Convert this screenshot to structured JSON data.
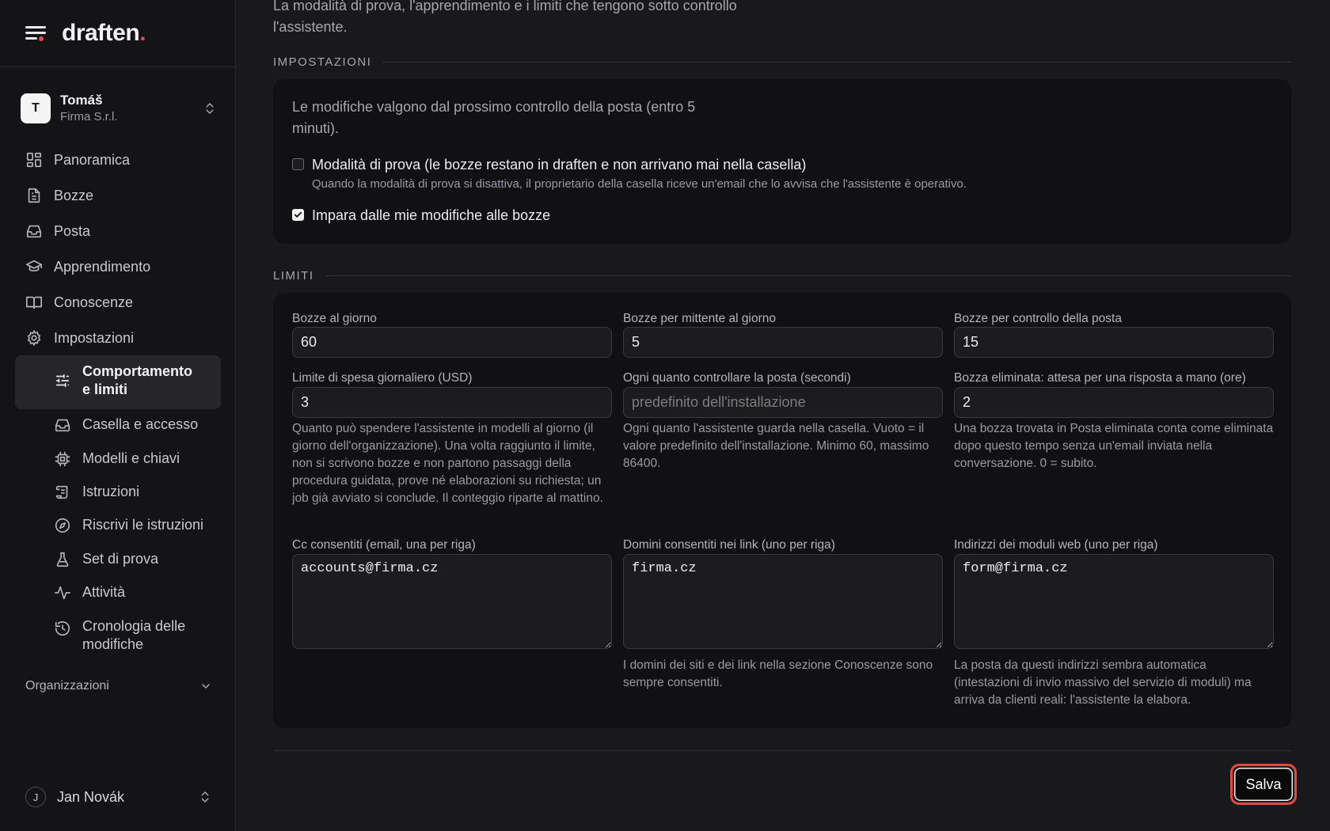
{
  "brand": {
    "logo_text": "draften",
    "logo_dot": "."
  },
  "org": {
    "avatar_letter": "T",
    "name": "Tomáš",
    "company": "Firma S.r.l."
  },
  "nav": {
    "items": [
      {
        "label": "Panoramica",
        "icon": "grid-icon"
      },
      {
        "label": "Bozze",
        "icon": "document-icon"
      },
      {
        "label": "Posta",
        "icon": "inbox-icon"
      },
      {
        "label": "Apprendimento",
        "icon": "graduation-cap-icon"
      },
      {
        "label": "Conoscenze",
        "icon": "book-open-icon"
      },
      {
        "label": "Impostazioni",
        "icon": "gear-icon"
      }
    ],
    "settings_sub": [
      {
        "label": "Comportamento e limiti",
        "icon": "sliders-icon",
        "active": true
      },
      {
        "label": "Casella e accesso",
        "icon": "inbox-icon"
      },
      {
        "label": "Modelli e chiavi",
        "icon": "cpu-icon"
      },
      {
        "label": "Istruzioni",
        "icon": "scroll-icon"
      },
      {
        "label": "Riscrivi le istruzioni",
        "icon": "compass-icon"
      },
      {
        "label": "Set di prova",
        "icon": "flask-icon"
      },
      {
        "label": "Attività",
        "icon": "activity-icon"
      },
      {
        "label": "Cronologia delle modifiche",
        "icon": "history-icon"
      }
    ],
    "organizations_label": "Organizzazioni"
  },
  "user": {
    "avatar_letter": "J",
    "name": "Jan Novák"
  },
  "intro_text": "La modalità di prova, l'apprendimento e i limiti che tengono sotto controllo l'assistente.",
  "impostazioni": {
    "heading": "IMPOSTAZIONI",
    "note": "Le modifiche valgono dal prossimo controllo della posta (entro 5 minuti).",
    "test_mode": {
      "label": "Modalità di prova (le bozze restano in draften e non arrivano mai nella casella)",
      "help": "Quando la modalità di prova si disattiva, il proprietario della casella riceve un'email che lo avvisa che l'assistente è operativo.",
      "checked": false
    },
    "learn": {
      "label": "Impara dalle mie modifiche alle bozze",
      "checked": true
    }
  },
  "limiti": {
    "heading": "LIMITI",
    "drafts_per_day": {
      "label": "Bozze al giorno",
      "value": "60"
    },
    "drafts_per_sender": {
      "label": "Bozze per mittente al giorno",
      "value": "5"
    },
    "drafts_per_check": {
      "label": "Bozze per controllo della posta",
      "value": "15"
    },
    "spend_limit": {
      "label": "Limite di spesa giornaliero (USD)",
      "value": "3",
      "help": "Quanto può spendere l'assistente in modelli al giorno (il giorno dell'organizzazione). Una volta raggiunto il limite, non si scrivono bozze e non partono passaggi della procedura guidata, prove né elaborazioni su richiesta; un job già avviato si conclude. Il conteggio riparte al mattino."
    },
    "check_interval": {
      "label": "Ogni quanto controllare la posta (secondi)",
      "value": "",
      "placeholder": "predefinito dell'installazione",
      "help": "Ogni quanto l'assistente guarda nella casella. Vuoto = il valore predefinito dell'installazione. Minimo 60, massimo 86400."
    },
    "deleted_wait": {
      "label": "Bozza eliminata: attesa per una risposta a mano (ore)",
      "value": "2",
      "help": "Una bozza trovata in Posta eliminata conta come eliminata dopo questo tempo senza un'email inviata nella conversazione. 0 = subito."
    },
    "allowed_cc": {
      "label": "Cc consentiti (email, una per riga)",
      "value": "accounts@firma.cz"
    },
    "allowed_domains": {
      "label": "Domini consentiti nei link (uno per riga)",
      "value": "firma.cz",
      "help": "I domini dei siti e dei link nella sezione Conoscenze sono sempre consentiti."
    },
    "web_form_addresses": {
      "label": "Indirizzi dei moduli web (uno per riga)",
      "value": "form@firma.cz",
      "help": "La posta da questi indirizzi sembra automatica (intestazioni di invio massivo del servizio di moduli) ma arriva da clienti reali: l'assistente la elabora."
    }
  },
  "save_label": "Salva",
  "colors": {
    "accent_red": "#e5484d",
    "background": "#19191b",
    "sidebar": "#141416",
    "card": "#111113"
  }
}
